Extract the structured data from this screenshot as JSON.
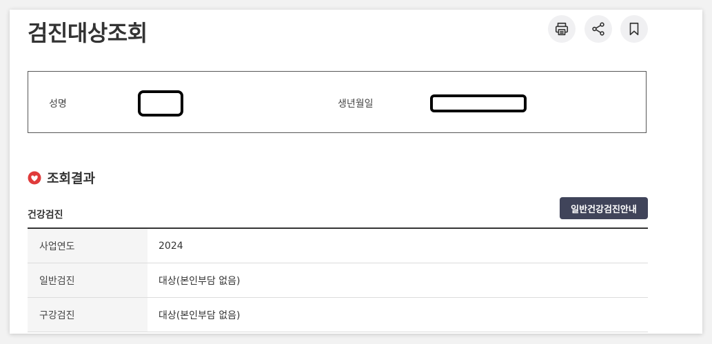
{
  "page": {
    "title": "검진대상조회"
  },
  "toolbar": {
    "print_icon": "printer-icon",
    "share_icon": "share-icon",
    "bookmark_icon": "bookmark-icon"
  },
  "info": {
    "name_label": "성명",
    "birth_label": "생년월일"
  },
  "result": {
    "section_title": "조회결과",
    "sub_title": "건강검진",
    "guide_button": "일반건강검진안내",
    "rows": [
      {
        "label": "사업연도",
        "value": "2024"
      },
      {
        "label": "일반검진",
        "value": "대상(본인부담 없음)"
      },
      {
        "label": "구강검진",
        "value": "대상(본인부담 없음)"
      }
    ]
  },
  "colors": {
    "accent_button": "#40445a",
    "section_icon": "#e03b3b"
  }
}
